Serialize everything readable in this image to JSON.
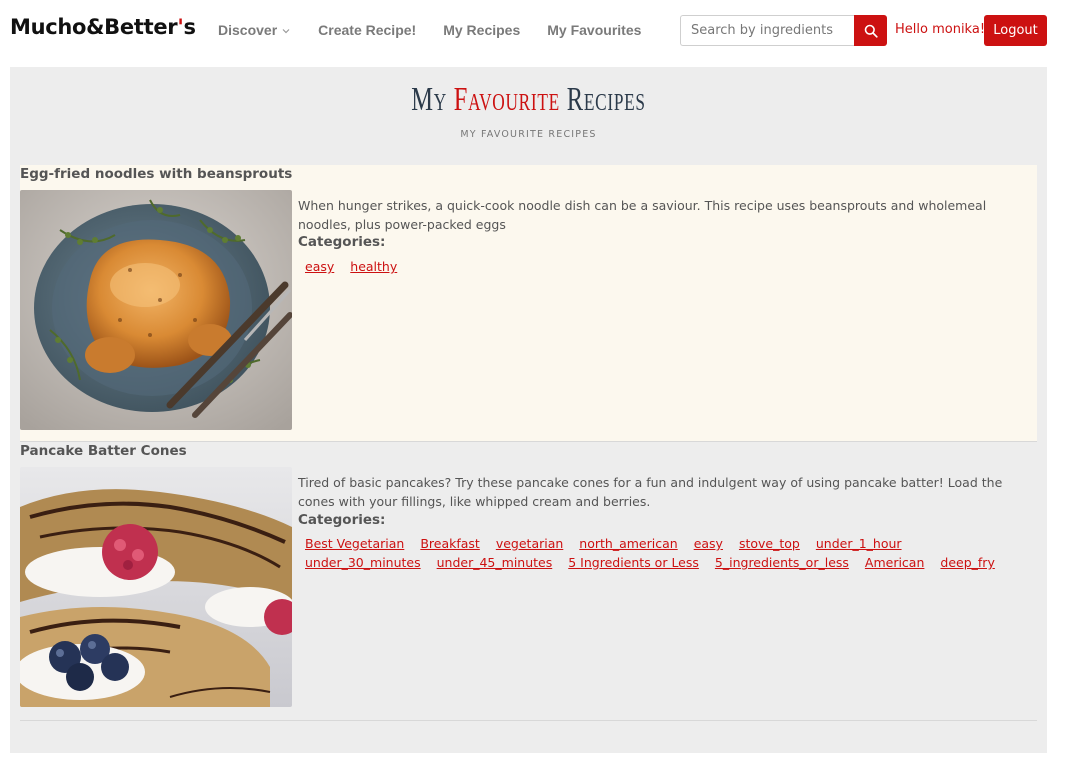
{
  "brand": {
    "name": "Mucho&Better",
    "apostrophe": "'",
    "suffix": "s"
  },
  "nav": {
    "discover": "Discover",
    "create": "Create Recipe!",
    "my_recipes": "My Recipes",
    "my_favourites": "My Favourites"
  },
  "search": {
    "placeholder": "Search by ingredients",
    "value": ""
  },
  "user": {
    "greeting": "Hello monika!",
    "logout": "Logout"
  },
  "page": {
    "title_part1": "My ",
    "title_accent": "Favourite",
    "title_part2": " Recipes",
    "subtitle": "MY FAVOURITE RECIPES"
  },
  "recipes": [
    {
      "title": "Egg-fried noodles with beansprouts",
      "description": "When hunger strikes, a quick-cook noodle dish can be a saviour. This recipe uses beansprouts and wholemeal noodles, plus power-packed eggs",
      "categories_label": "Categories:",
      "categories": [
        "easy",
        "healthy"
      ]
    },
    {
      "title": "Pancake Batter Cones",
      "description": "Tired of basic pancakes? Try these pancake cones for a fun and indulgent way of using pancake batter! Load the cones with your fillings, like whipped cream and berries.",
      "categories_label": "Categories:",
      "categories": [
        "Best Vegetarian",
        "Breakfast",
        "vegetarian",
        "north_american",
        "easy",
        "stove_top",
        "under_1_hour",
        "under_30_minutes",
        "under_45_minutes",
        "5 Ingredients or Less",
        "5_ingredients_or_less",
        "American",
        "deep_fry"
      ]
    }
  ],
  "colors": {
    "accent": "#cc1111",
    "panel": "#ededed",
    "highlight_row": "#fcf8ee"
  },
  "icons": {
    "search": "search-icon",
    "caret": "chevron-down-icon"
  }
}
